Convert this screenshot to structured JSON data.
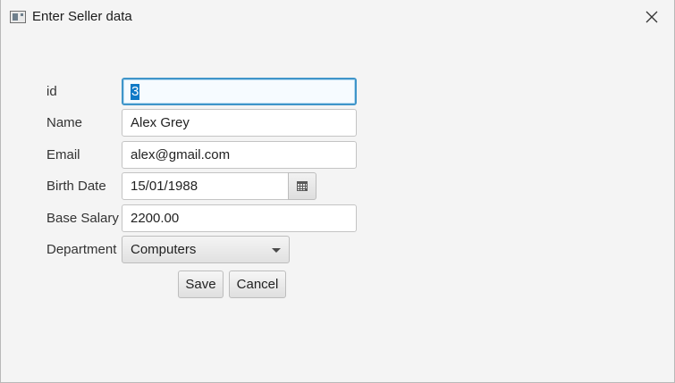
{
  "window": {
    "title": "Enter Seller data"
  },
  "form": {
    "id_label": "id",
    "id_value": "3",
    "name_label": "Name",
    "name_value": "Alex Grey",
    "email_label": "Email",
    "email_value": "alex@gmail.com",
    "birth_date_label": "Birth Date",
    "birth_date_value": "15/01/1988",
    "base_salary_label": "Base Salary",
    "base_salary_value": "2200.00",
    "department_label": "Department",
    "department_selected": "Computers"
  },
  "buttons": {
    "save_label": "Save",
    "cancel_label": "Cancel"
  },
  "icons": {
    "app": "app-window-icon",
    "close": "close-icon",
    "calendar": "calendar-icon",
    "dropdown": "chevron-down-icon"
  },
  "colors": {
    "focus_border": "#3f95c9",
    "selection": "#0f79c6"
  }
}
